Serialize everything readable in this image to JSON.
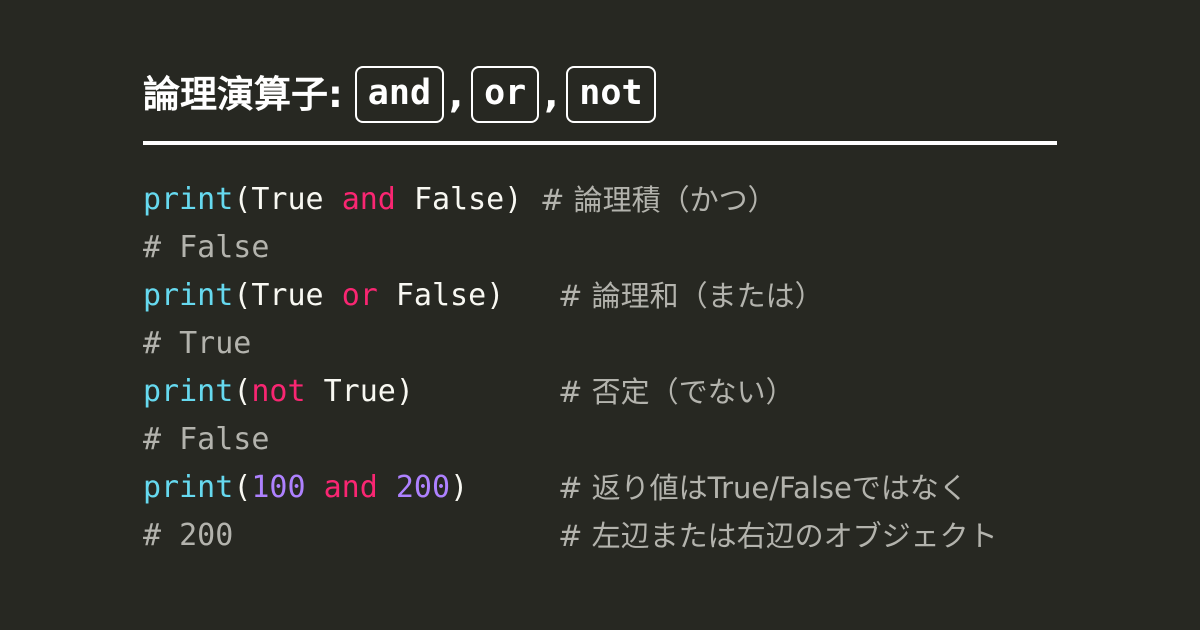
{
  "theme": {
    "background": "#272822",
    "foreground": "#f8f8f2",
    "function_color": "#66d9ef",
    "keyword_color": "#f92672",
    "number_color": "#ae81ff",
    "comment_color": "#b3b3ad",
    "rule_color": "#ffffff"
  },
  "title": {
    "prefix": "論理演算子:",
    "keywords": [
      "and",
      "or",
      "not"
    ],
    "separator": ","
  },
  "code": {
    "lines": [
      {
        "id": "line-1",
        "tokens": [
          {
            "text": "print",
            "type": "function"
          },
          {
            "text": "(",
            "type": "punct"
          },
          {
            "text": "True",
            "type": "const"
          },
          {
            "text": " ",
            "type": "punct"
          },
          {
            "text": "and",
            "type": "keyword"
          },
          {
            "text": " ",
            "type": "punct"
          },
          {
            "text": "False",
            "type": "const"
          },
          {
            "text": ")",
            "type": "punct"
          }
        ],
        "comment": "# 論理積（かつ）",
        "comment_col": 22
      },
      {
        "id": "line-2",
        "tokens": [
          {
            "text": "# False",
            "type": "comment"
          }
        ],
        "comment": "",
        "comment_col": 0
      },
      {
        "id": "line-3",
        "tokens": [
          {
            "text": "print",
            "type": "function"
          },
          {
            "text": "(",
            "type": "punct"
          },
          {
            "text": "True",
            "type": "const"
          },
          {
            "text": " ",
            "type": "punct"
          },
          {
            "text": "or",
            "type": "keyword"
          },
          {
            "text": " ",
            "type": "punct"
          },
          {
            "text": "False",
            "type": "const"
          },
          {
            "text": ")",
            "type": "punct"
          }
        ],
        "comment": "# 論理和（または）",
        "comment_col": 23
      },
      {
        "id": "line-4",
        "tokens": [
          {
            "text": "# True",
            "type": "comment"
          }
        ],
        "comment": "",
        "comment_col": 0
      },
      {
        "id": "line-5",
        "tokens": [
          {
            "text": "print",
            "type": "function"
          },
          {
            "text": "(",
            "type": "punct"
          },
          {
            "text": "not",
            "type": "keyword"
          },
          {
            "text": " ",
            "type": "punct"
          },
          {
            "text": "True",
            "type": "const"
          },
          {
            "text": ")",
            "type": "punct"
          }
        ],
        "comment": "# 否定（でない）",
        "comment_col": 23
      },
      {
        "id": "line-6",
        "tokens": [
          {
            "text": "# False",
            "type": "comment"
          }
        ],
        "comment": "",
        "comment_col": 0
      },
      {
        "id": "line-7",
        "tokens": [
          {
            "text": "print",
            "type": "function"
          },
          {
            "text": "(",
            "type": "punct"
          },
          {
            "text": "100",
            "type": "number"
          },
          {
            "text": " ",
            "type": "punct"
          },
          {
            "text": "and",
            "type": "keyword"
          },
          {
            "text": " ",
            "type": "punct"
          },
          {
            "text": "200",
            "type": "number"
          },
          {
            "text": ")",
            "type": "punct"
          }
        ],
        "comment": "# 返り値はTrue/Falseではなく",
        "comment_col": 23
      },
      {
        "id": "line-8",
        "tokens": [
          {
            "text": "# 200",
            "type": "comment"
          }
        ],
        "comment": "# 左辺または右辺のオブジェクト",
        "comment_col": 23
      }
    ]
  }
}
